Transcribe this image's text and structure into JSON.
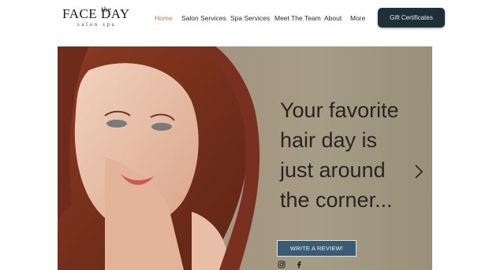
{
  "header": {
    "logo": {
      "main": "FACE   DAY",
      "script": "the",
      "sub": "salon spa"
    },
    "nav": [
      {
        "label": "Home",
        "active": true
      },
      {
        "label": "Salon Services",
        "active": false
      },
      {
        "label": "Spa Services",
        "active": false
      },
      {
        "label": "Meet The Team",
        "active": false
      },
      {
        "label": "About",
        "active": false
      },
      {
        "label": "More",
        "active": false
      }
    ],
    "cta_label": "Gift Certificates"
  },
  "hero": {
    "headline_lines": [
      "Your favorite",
      "hair day is",
      "just around",
      "the corner..."
    ],
    "review_button": "WRITE A REVIEW!",
    "next_icon": "chevron-right-icon",
    "social": [
      "instagram-icon",
      "facebook-icon"
    ]
  },
  "colors": {
    "accent": "#b07a4f",
    "cta_bg": "#1d2f37",
    "review_bg": "#3c5a71",
    "hero_bg": "#a49680"
  }
}
